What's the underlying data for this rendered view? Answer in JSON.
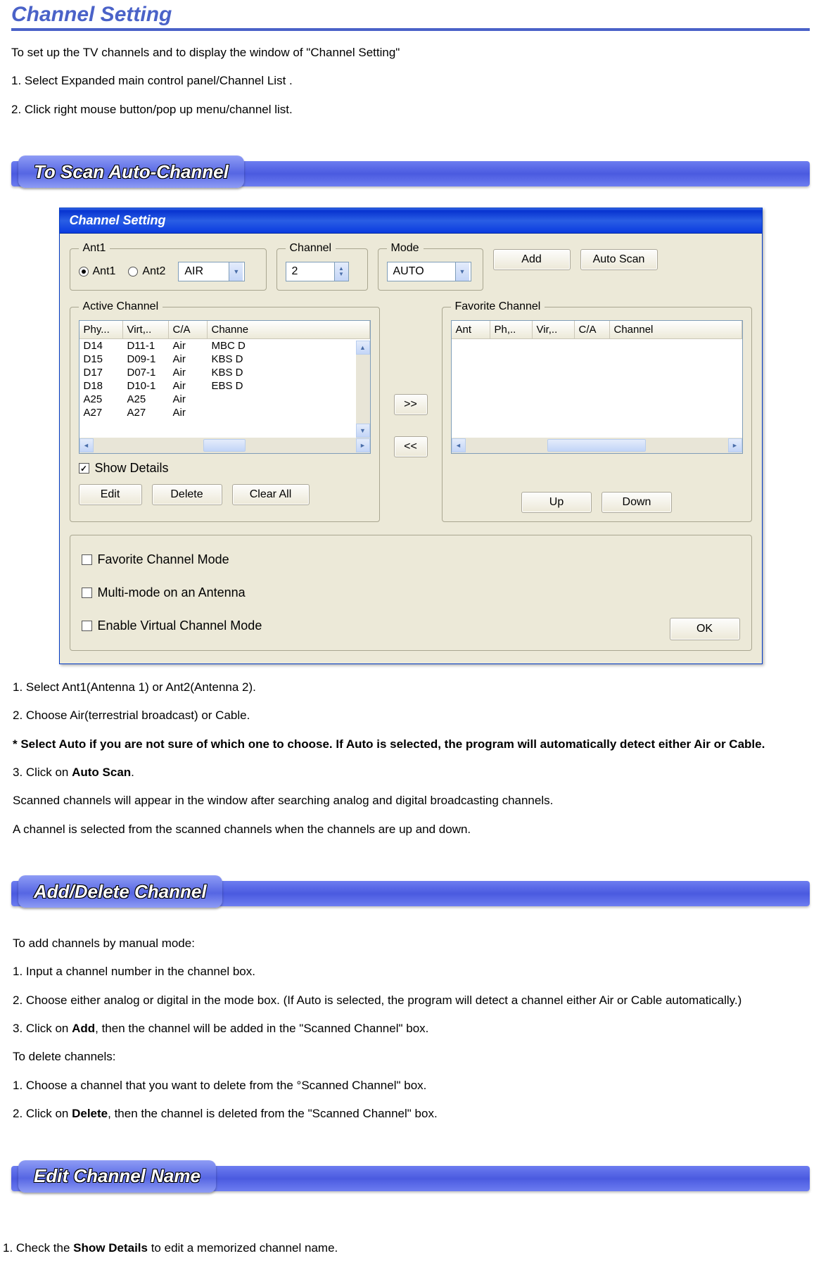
{
  "page_title": "Channel Setting",
  "intro": {
    "p1": "To set up the TV channels and to display the window of \"Channel Setting\"",
    "p2": "1. Select Expanded main control panel/Channel List .",
    "p3": "2. Click right mouse button/pop up menu/channel list."
  },
  "sections": {
    "scan": {
      "title": "To Scan Auto-Channel"
    },
    "add_delete": {
      "title": "Add/Delete Channel"
    },
    "edit_name": {
      "title": "Edit Channel Name"
    }
  },
  "dialog": {
    "title": "Channel Setting",
    "ant_group": {
      "legend": "Ant1",
      "radio1": "Ant1",
      "radio2": "Ant2",
      "combo_value": "AIR"
    },
    "channel_group": {
      "legend": "Channel",
      "value": "2"
    },
    "mode_group": {
      "legend": "Mode",
      "value": "AUTO"
    },
    "btn_add": "Add",
    "btn_autoscan": "Auto Scan",
    "active": {
      "legend": "Active Channel",
      "cols": {
        "c1": "Phy...",
        "c2": "Virt,..",
        "c3": "C/A",
        "c4": "Channe"
      },
      "rows": [
        {
          "c1": "D14",
          "c2": "D11-1",
          "c3": "Air",
          "c4": "MBC D"
        },
        {
          "c1": "D15",
          "c2": "D09-1",
          "c3": "Air",
          "c4": "KBS D"
        },
        {
          "c1": "D17",
          "c2": "D07-1",
          "c3": "Air",
          "c4": "KBS D"
        },
        {
          "c1": "D18",
          "c2": "D10-1",
          "c3": "Air",
          "c4": "EBS D"
        },
        {
          "c1": "A25",
          "c2": "A25",
          "c3": "Air",
          "c4": ""
        },
        {
          "c1": "A27",
          "c2": "A27",
          "c3": "Air",
          "c4": ""
        }
      ],
      "show_details": "Show Details",
      "btn_edit": "Edit",
      "btn_delete": "Delete",
      "btn_clear": "Clear All"
    },
    "move": {
      "to_fav": ">>",
      "from_fav": "<<"
    },
    "favorite": {
      "legend": "Favorite Channel",
      "cols": {
        "c1": "Ant",
        "c2": "Ph,..",
        "c3": "Vir,..",
        "c4": "C/A",
        "c5": "Channel"
      },
      "btn_up": "Up",
      "btn_down": "Down"
    },
    "options": {
      "fav_mode": "Favorite Channel Mode",
      "multi_mode": "Multi-mode on an Antenna",
      "virtual_mode": "Enable Virtual Channel Mode"
    },
    "btn_ok": "OK"
  },
  "scan_text": {
    "p1": "1. Select Ant1(Antenna 1) or Ant2(Antenna 2).",
    "p2": "2. Choose Air(terrestrial broadcast) or Cable.",
    "p3": "* Select Auto if you are not sure of which one to choose. If Auto is selected, the program will automatically detect either Air or Cable.",
    "p4a": "3. Click on ",
    "p4b": "Auto Scan",
    "p4c": ".",
    "p5": "Scanned channels will appear in the window after searching analog and digital broadcasting channels.",
    "p6": "A channel is selected from the scanned channels when the channels are up and down."
  },
  "adddel_text": {
    "p1": "To add channels by manual mode:",
    "p2": "1. Input a channel number in the channel box.",
    "p3": "2. Choose either analog or digital in the mode box. (If Auto is selected, the program will detect a channel either Air or Cable automatically.)",
    "p4a": "3. Click on ",
    "p4b": "Add",
    "p4c": ", then the channel will be added in the \"Scanned Channel\" box.",
    "p5": "To delete channels:",
    "p6": "1. Choose a channel that you want to delete from the °Scanned Channel\" box.",
    "p7a": "2. Click on ",
    "p7b": "Delete",
    "p7c": ", then the channel is deleted from the \"Scanned Channel\" box."
  },
  "editname_text": {
    "p1a": "1. Check the ",
    "p1b": "Show Details",
    "p1c": " to edit a memorized channel name."
  }
}
